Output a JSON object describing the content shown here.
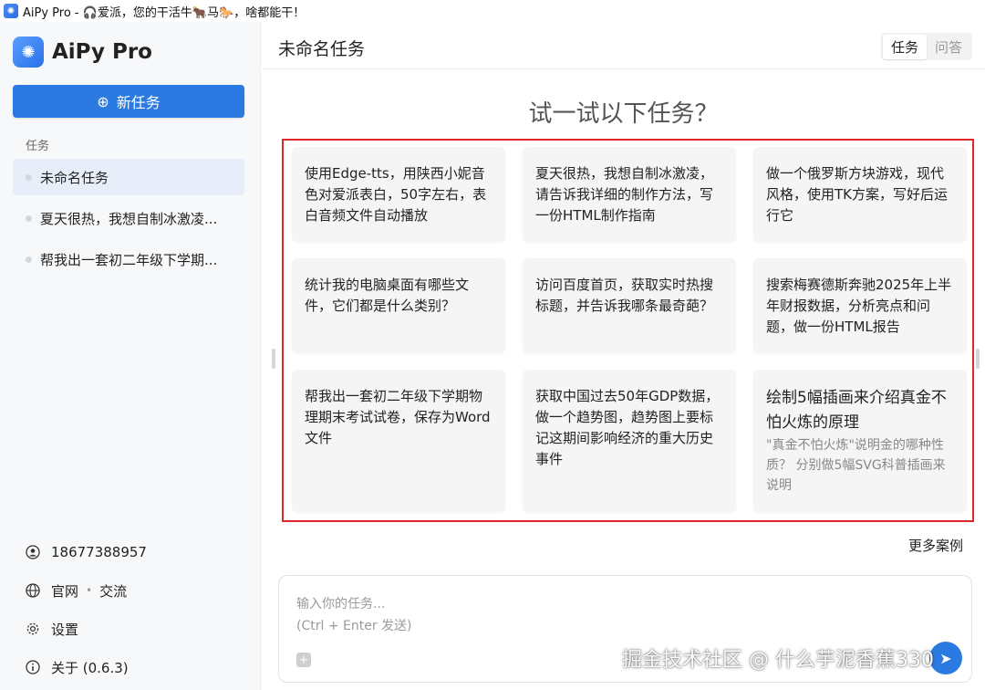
{
  "window": {
    "title": "AiPy Pro - 🎧爱派，您的干活牛🐂马🐎，啥都能干！"
  },
  "brand": {
    "name": "AiPy Pro"
  },
  "sidebar": {
    "new_task_label": "新任务",
    "section_label": "任务",
    "tasks": [
      {
        "label": "未命名任务",
        "active": true
      },
      {
        "label": "夏天很热，我想自制冰激凌...",
        "active": false
      },
      {
        "label": "帮我出一套初二年级下学期...",
        "active": false
      }
    ],
    "phone": "18677388957",
    "website_label": "官网",
    "community_label": "交流",
    "settings_label": "设置",
    "about_label": "关于 (0.6.3)"
  },
  "header": {
    "title": "未命名任务",
    "tabs": [
      {
        "label": "任务",
        "active": true
      },
      {
        "label": "问答",
        "active": false
      }
    ]
  },
  "main": {
    "heading": "试一试以下任务？",
    "cards": [
      {
        "text": "使用Edge-tts，用陕西小妮音色对爱派表白，50字左右，表白音频文件自动播放"
      },
      {
        "text": "夏天很热，我想自制冰激凌，请告诉我详细的制作方法，写一份HTML制作指南"
      },
      {
        "text": "做一个俄罗斯方块游戏，现代风格，使用TK方案，写好后运行它"
      },
      {
        "text": "统计我的电脑桌面有哪些文件，它们都是什么类别？"
      },
      {
        "text": "访问百度首页，获取实时热搜标题，并告诉我哪条最奇葩？"
      },
      {
        "text": "搜索梅赛德斯奔驰2025年上半年财报数据，分析亮点和问题，做一份HTML报告"
      },
      {
        "text": "帮我出一套初二年级下学期物理期末考试试卷，保存为Word文件"
      },
      {
        "text": "获取中国过去50年GDP数据，做一个趋势图，趋势图上要标记这期间影响经济的重大历史事件"
      },
      {
        "title": "绘制5幅插画来介绍真金不怕火炼的原理",
        "desc": "\"真金不怕火炼\"说明金的哪种性质？ 分别做5幅SVG科普插画来说明"
      }
    ],
    "more_label": "更多案例"
  },
  "input": {
    "placeholder_line1": "输入你的任务...",
    "placeholder_line2": "(Ctrl + Enter 发送)"
  },
  "watermark": "掘金技术社区 @ 什么芋泥香蕉330",
  "colors": {
    "accent": "#2a7ae2",
    "highlight_border": "#e0282b"
  }
}
